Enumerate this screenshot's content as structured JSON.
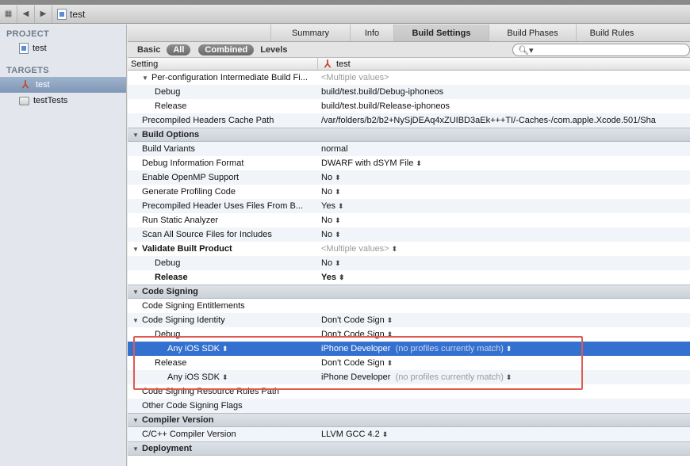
{
  "window": {
    "crumb": "test"
  },
  "jumpbar": {
    "grid_icon": "grid-icon",
    "back_icon": "back-icon",
    "forward_icon": "forward-icon"
  },
  "sidebar": {
    "project_header": "PROJECT",
    "project_item": "test",
    "targets_header": "TARGETS",
    "targets": [
      {
        "label": "test"
      },
      {
        "label": "testTests"
      }
    ]
  },
  "tabs": [
    "Summary",
    "Info",
    "Build Settings",
    "Build Phases",
    "Build Rules"
  ],
  "filter": {
    "basic": "Basic",
    "all": "All",
    "combined": "Combined",
    "levels": "Levels",
    "search_icon": "search-icon"
  },
  "columns": {
    "setting": "Setting",
    "target": "test"
  },
  "rows": {
    "r0": {
      "name": "Per-configuration Intermediate Build Fi...",
      "value": "<Multiple values>"
    },
    "r1": {
      "name": "Debug",
      "value": "build/test.build/Debug-iphoneos"
    },
    "r2": {
      "name": "Release",
      "value": "build/test.build/Release-iphoneos"
    },
    "r3": {
      "name": "Precompiled Headers Cache Path",
      "value": "/var/folders/b2/b2+NySjDEAq4xZUIBD3aEk+++TI/-Caches-/com.apple.Xcode.501/Sha"
    },
    "s1": {
      "name": "Build Options"
    },
    "r4": {
      "name": "Build Variants",
      "value": "normal"
    },
    "r5": {
      "name": "Debug Information Format",
      "value": "DWARF with dSYM File"
    },
    "r6": {
      "name": "Enable OpenMP Support",
      "value": "No"
    },
    "r7": {
      "name": "Generate Profiling Code",
      "value": "No"
    },
    "r8": {
      "name": "Precompiled Header Uses Files From B...",
      "value": "Yes"
    },
    "r9": {
      "name": "Run Static Analyzer",
      "value": "No"
    },
    "r10": {
      "name": "Scan All Source Files for Includes",
      "value": "No"
    },
    "r11": {
      "name": "Validate Built Product",
      "value": "<Multiple values>"
    },
    "r12": {
      "name": "Debug",
      "value": "No"
    },
    "r13": {
      "name": "Release",
      "value": "Yes"
    },
    "s2": {
      "name": "Code Signing"
    },
    "r14": {
      "name": "Code Signing Entitlements",
      "value": ""
    },
    "r15": {
      "name": "Code Signing Identity",
      "value": "Don't Code Sign"
    },
    "r16": {
      "name": "Debug",
      "value": "Don't Code Sign"
    },
    "r17": {
      "name": "Any iOS SDK",
      "value": "iPhone Developer",
      "note": "(no profiles currently match)"
    },
    "r18": {
      "name": "Release",
      "value": "Don't Code Sign"
    },
    "r19": {
      "name": "Any iOS SDK",
      "value": "iPhone Developer",
      "note": "(no profiles currently match)"
    },
    "r20": {
      "name": "Code Signing Resource Rules Path",
      "value": ""
    },
    "r21": {
      "name": "Other Code Signing Flags",
      "value": ""
    },
    "s3": {
      "name": "Compiler Version"
    },
    "r22": {
      "name": "C/C++ Compiler Version",
      "value": "LLVM GCC 4.2"
    },
    "s4": {
      "name": "Deployment"
    }
  },
  "colors": {
    "selection": "#3470cf",
    "highlight_box": "#e05a52",
    "sidebar_selection": "#8ea4c1"
  }
}
